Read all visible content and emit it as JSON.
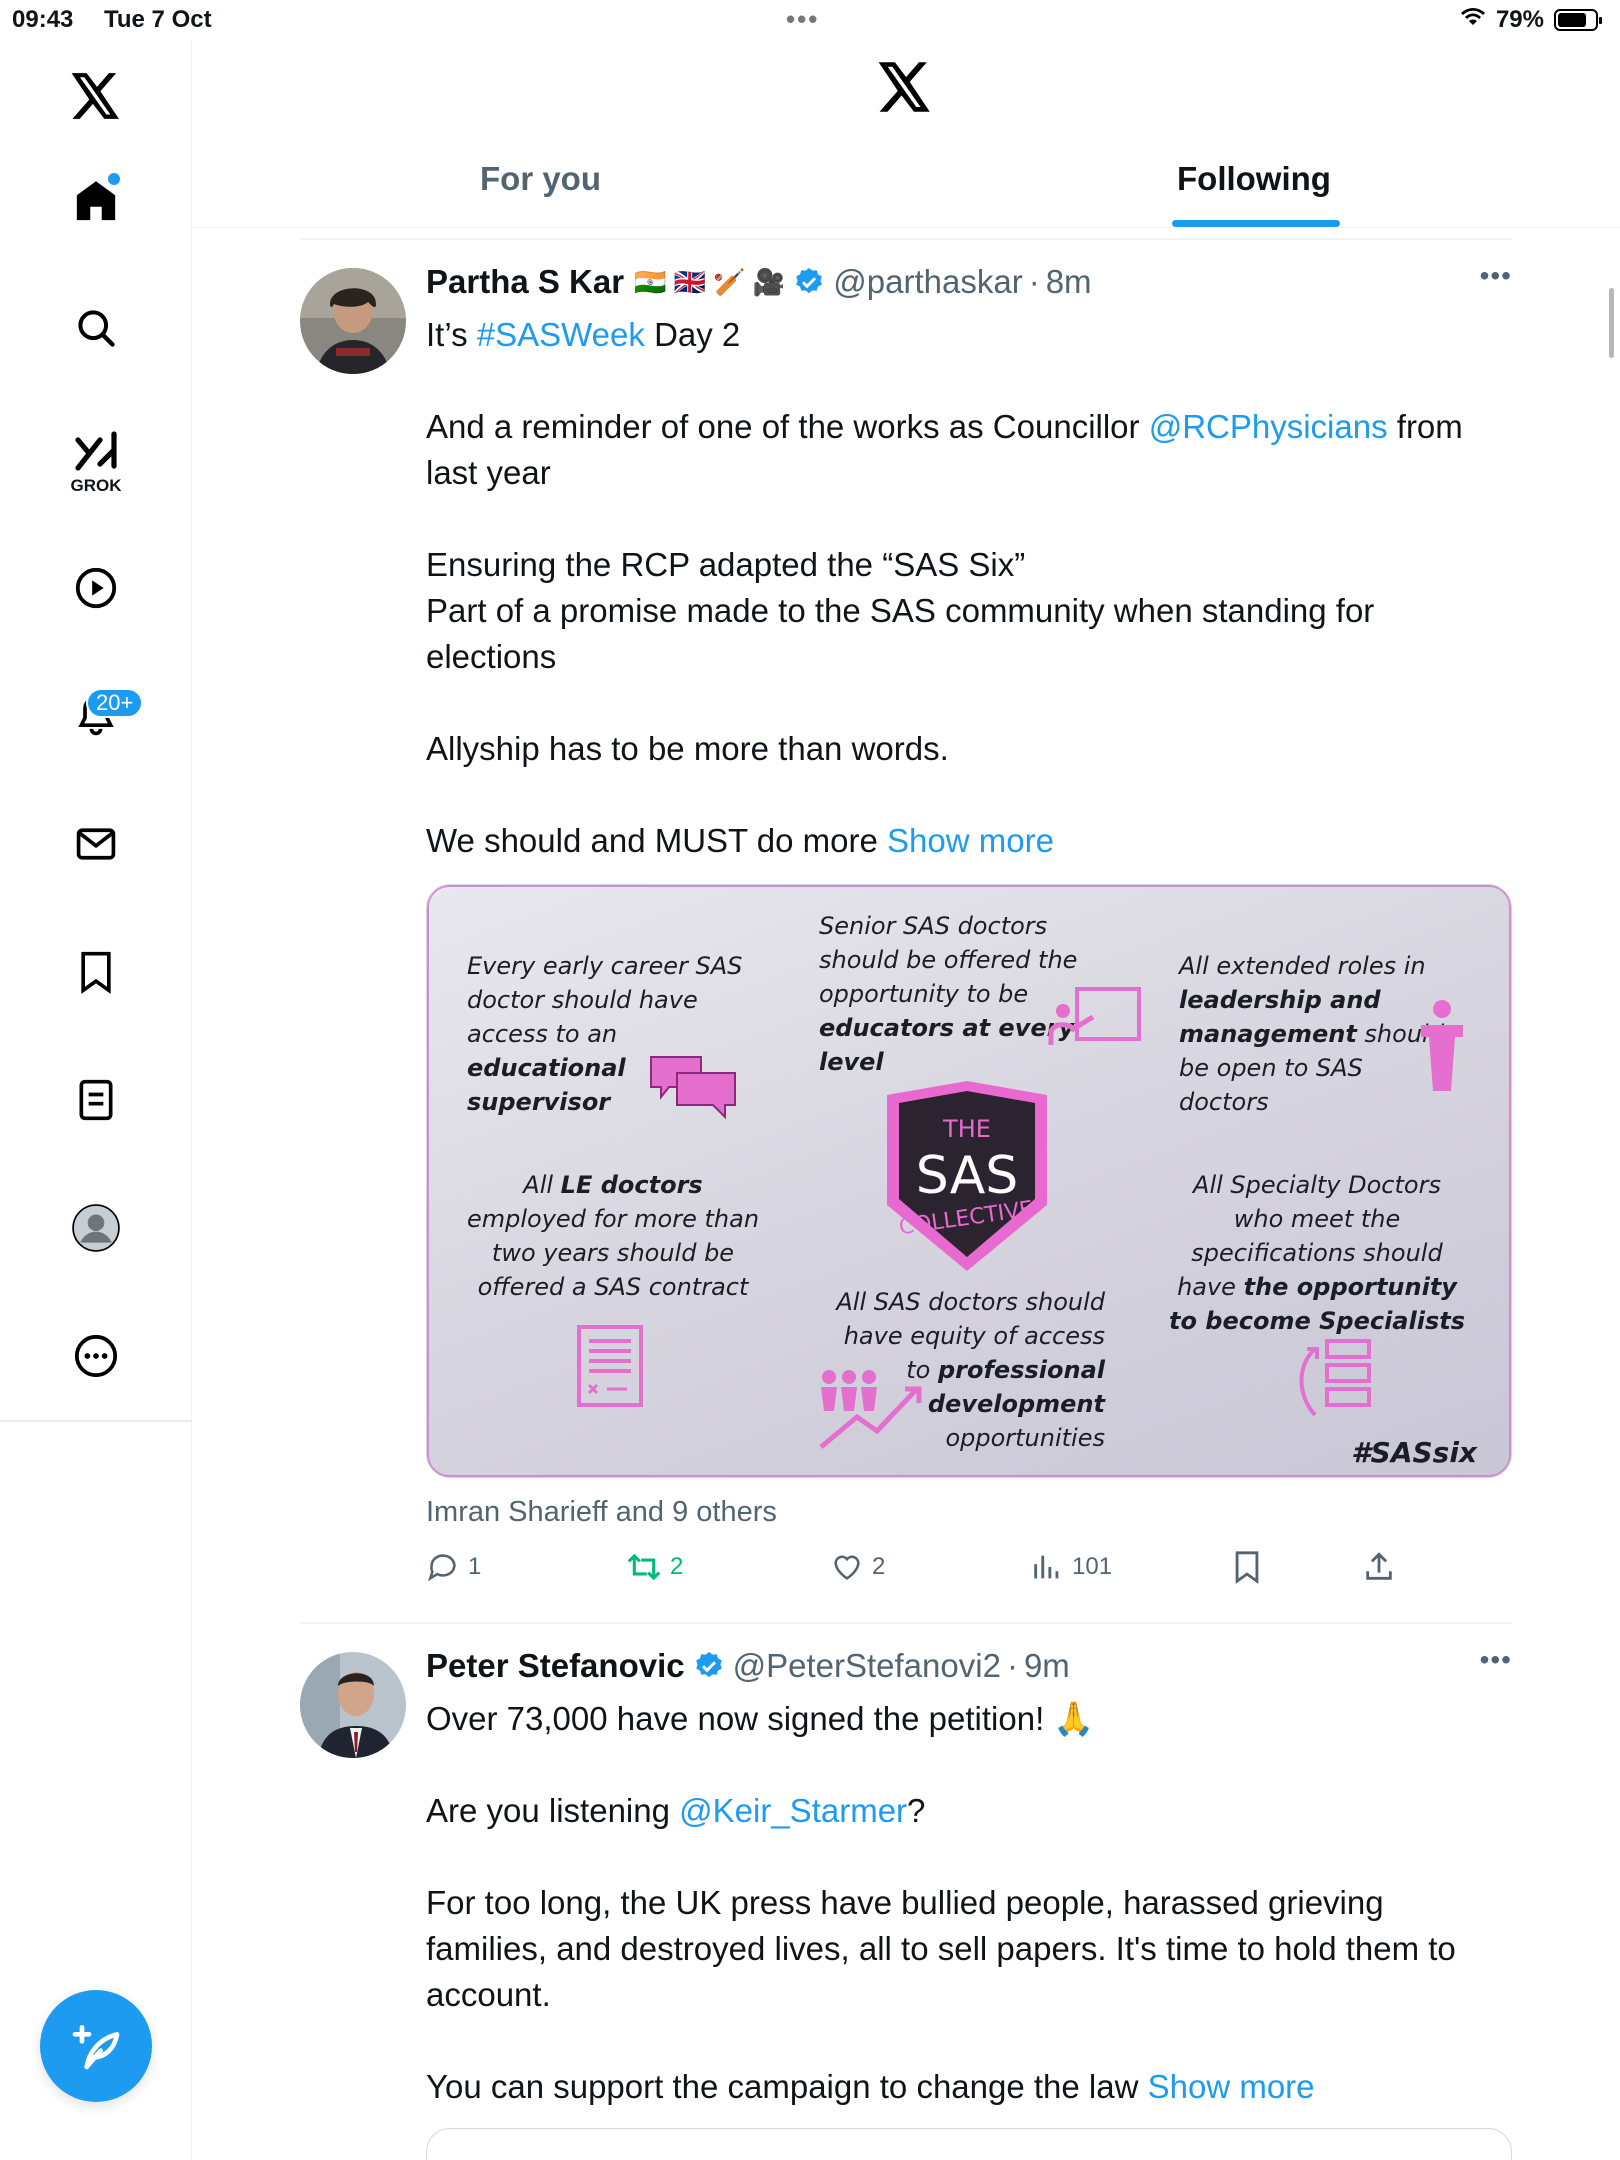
{
  "status_bar": {
    "time": "09:43",
    "date": "Tue 7 Oct",
    "battery": "79%"
  },
  "sidebar": {
    "notifications_badge": "20+",
    "grok_label": "GROK"
  },
  "header": {
    "tabs": [
      {
        "label": "For you",
        "active": false
      },
      {
        "label": "Following",
        "active": true
      }
    ]
  },
  "tweets": [
    {
      "name": "Partha S Kar",
      "name_emojis": "🇮🇳 🇬🇧 🏏 🎥",
      "handle": "@parthaskar",
      "time": "8m",
      "text": {
        "l1_a": "It’s ",
        "l1_tag": "#SASWeek",
        "l1_b": " Day 2",
        "l2_a": "And a reminder of one of the works as Councillor ",
        "l2_mention": "@RCPhysicians",
        "l2_b": " from last year",
        "l3": "Ensuring the RCP adapted the “SAS Six”",
        "l4": "Part of a promise made to the SAS community when standing for elections",
        "l5": "Allyship has to be more than words.",
        "l6": "We should and MUST do more ",
        "show_more": "Show more"
      },
      "image": {
        "b1_a": "Every early career SAS doctor should have access to an ",
        "b1_b": "educational supervisor",
        "b2_a": "Senior SAS doctors should be offered the opportunity to be ",
        "b2_b": "educators at every level",
        "b3_a": "All extended roles in ",
        "b3_b": "leadership and management",
        "b3_c": " should be open to SAS doctors",
        "b4_a": "All ",
        "b4_b": "LE doctors",
        "b4_c": " employed for more than two years should be offered a SAS contract",
        "b5_a": "All Specialty Doctors who meet the specifications should have ",
        "b5_b": "the opportunity to become Specialists",
        "b6_a": "All SAS doctors should have equity of access to ",
        "b6_b": "professional development",
        "b6_c": " opportunities",
        "shield_top": "THE",
        "shield_mid": "SAS",
        "shield_bottom": "COLLECTIVE",
        "hashtag": "#SASsix"
      },
      "reposted_by": "Imran Sharieff and 9 others",
      "stats": {
        "replies": "1",
        "reposts": "2",
        "likes": "2",
        "views": "101"
      }
    },
    {
      "name": "Peter Stefanovic",
      "handle": "@PeterStefanovi2",
      "time": "9m",
      "text": {
        "l1": "Over 73,000 have now signed the petition! 🙏",
        "l2_a": "Are you listening ",
        "l2_mention": "@Keir_Starmer",
        "l2_b": "?",
        "l3": "For too long, the UK press have bullied people, harassed grieving families, and destroyed lives, all to sell papers. It's time to hold them to account.",
        "l4": "You can support the campaign to change the law ",
        "show_more": "Show more"
      }
    }
  ],
  "colors": {
    "accent": "#1d9bf0",
    "repost": "#00ba7c",
    "muted": "#536471"
  }
}
